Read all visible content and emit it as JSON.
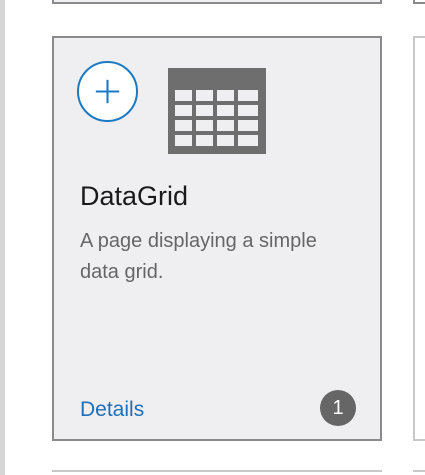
{
  "card": {
    "title": "DataGrid",
    "description": "A page displaying a simple data grid.",
    "details_label": "Details",
    "count": "1",
    "add_icon": "plus-circle-icon",
    "preview_icon": "data-grid-icon"
  },
  "colors": {
    "accent": "#1b7ac4",
    "link": "#1f6fb8",
    "card_background": "#efeff2",
    "card_border": "#8a8a8a",
    "badge_background": "#666666",
    "grid_icon": "#6e6e6e"
  }
}
